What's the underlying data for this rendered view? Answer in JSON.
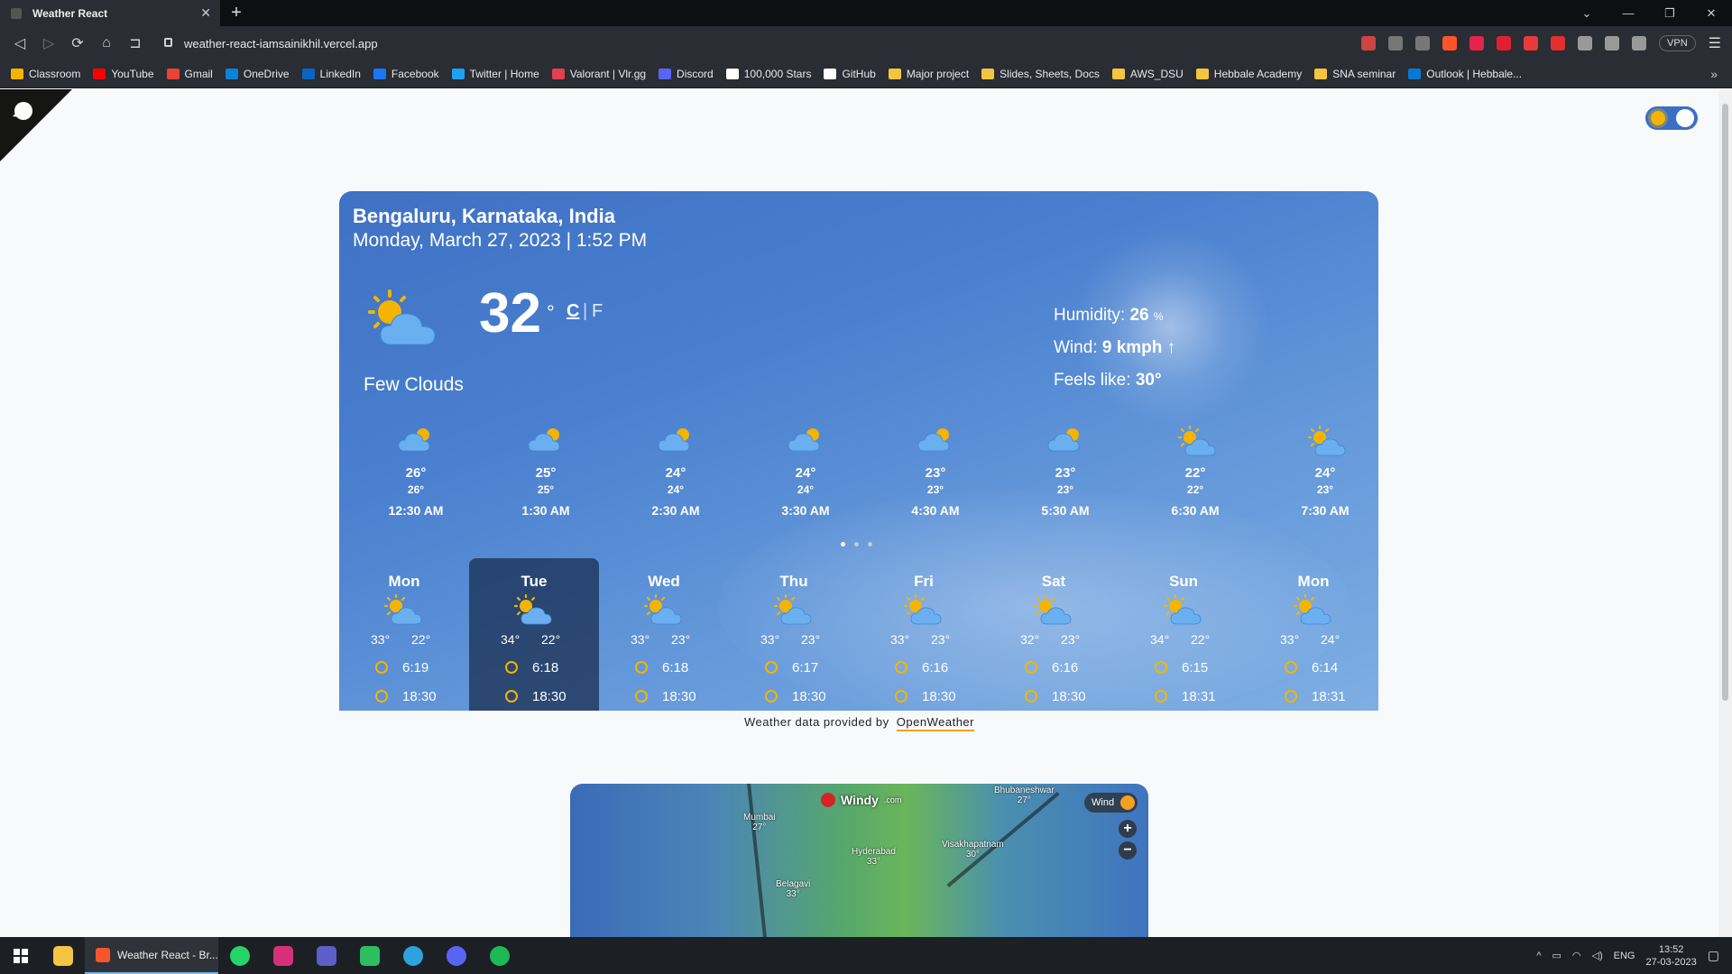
{
  "browser": {
    "tab_title": "Weather React",
    "url": "weather-react-iamsainikhil.vercel.app",
    "vpn_label": "VPN",
    "bookmarks": [
      {
        "label": "Classroom",
        "color": "#f4b400"
      },
      {
        "label": "YouTube",
        "color": "#ff0000"
      },
      {
        "label": "Gmail",
        "color": "#ea4335"
      },
      {
        "label": "OneDrive",
        "color": "#0a84d8"
      },
      {
        "label": "LinkedIn",
        "color": "#0a66c2"
      },
      {
        "label": "Facebook",
        "color": "#1877f2"
      },
      {
        "label": "Twitter | Home",
        "color": "#1da1f2"
      },
      {
        "label": "Valorant | Vlr.gg",
        "color": "#e04050"
      },
      {
        "label": "Discord",
        "color": "#5865f2"
      },
      {
        "label": "100,000 Stars",
        "color": "#ffffff"
      },
      {
        "label": "GitHub",
        "color": "#ffffff"
      },
      {
        "label": "Major project",
        "color": "#f5c542"
      },
      {
        "label": "Slides, Sheets, Docs",
        "color": "#f5c542"
      },
      {
        "label": "AWS_DSU",
        "color": "#f5c542"
      },
      {
        "label": "Hebbale Academy",
        "color": "#f5c542"
      },
      {
        "label": "SNA seminar",
        "color": "#f5c542"
      },
      {
        "label": "Outlook | Hebbale...",
        "color": "#0a78d4"
      }
    ],
    "more_bookmarks": "»"
  },
  "weather": {
    "location": "Bengaluru, Karnataka, India",
    "datetime": "Monday, March 27, 2023 | 1:52 PM",
    "temperature": "32",
    "degree_symbol": "°",
    "unit_c": "C",
    "unit_sep": "|",
    "unit_f": "F",
    "condition": "Few Clouds",
    "humidity_label": "Humidity:",
    "humidity_value": "26",
    "humidity_unit": "%",
    "wind_label": "Wind:",
    "wind_value": "9 kmph",
    "wind_arrow": "↑",
    "feels_label": "Feels like:",
    "feels_value": "30°"
  },
  "hourly": [
    {
      "temp": "26°",
      "feels": "26°",
      "time": "12:30 AM",
      "icon": "moon-cloud-icon"
    },
    {
      "temp": "25°",
      "feels": "25°",
      "time": "1:30 AM",
      "icon": "moon-cloud-icon"
    },
    {
      "temp": "24°",
      "feels": "24°",
      "time": "2:30 AM",
      "icon": "moon-cloud-icon"
    },
    {
      "temp": "24°",
      "feels": "24°",
      "time": "3:30 AM",
      "icon": "moon-cloud-icon"
    },
    {
      "temp": "23°",
      "feels": "23°",
      "time": "4:30 AM",
      "icon": "moon-cloud-icon"
    },
    {
      "temp": "23°",
      "feels": "23°",
      "time": "5:30 AM",
      "icon": "moon-cloud-icon"
    },
    {
      "temp": "22°",
      "feels": "22°",
      "time": "6:30 AM",
      "icon": "sun-cloud-icon"
    },
    {
      "temp": "24°",
      "feels": "23°",
      "time": "7:30 AM",
      "icon": "sun-cloud-icon"
    }
  ],
  "daily": [
    {
      "day": "Mon",
      "high": "33°",
      "low": "22°",
      "sunrise": "6:19",
      "sunset": "18:30",
      "selected": false
    },
    {
      "day": "Tue",
      "high": "34°",
      "low": "22°",
      "sunrise": "6:18",
      "sunset": "18:30",
      "selected": true
    },
    {
      "day": "Wed",
      "high": "33°",
      "low": "23°",
      "sunrise": "6:18",
      "sunset": "18:30",
      "selected": false
    },
    {
      "day": "Thu",
      "high": "33°",
      "low": "23°",
      "sunrise": "6:17",
      "sunset": "18:30",
      "selected": false
    },
    {
      "day": "Fri",
      "high": "33°",
      "low": "23°",
      "sunrise": "6:16",
      "sunset": "18:30",
      "selected": false
    },
    {
      "day": "Sat",
      "high": "32°",
      "low": "23°",
      "sunrise": "6:16",
      "sunset": "18:30",
      "selected": false
    },
    {
      "day": "Sun",
      "high": "34°",
      "low": "22°",
      "sunrise": "6:15",
      "sunset": "18:31",
      "selected": false
    },
    {
      "day": "Mon",
      "high": "33°",
      "low": "24°",
      "sunrise": "6:14",
      "sunset": "18:31",
      "selected": false
    }
  ],
  "footer": {
    "credit_text": "Weather data provided by",
    "credit_link": "OpenWeather"
  },
  "map": {
    "brand": "Windy",
    "brand_suffix": ".com",
    "layer_label": "Wind",
    "zoom_in": "+",
    "zoom_out": "−",
    "cities": [
      {
        "name": "Mumbai",
        "temp": "27°"
      },
      {
        "name": "Hyderabad",
        "temp": "33°"
      },
      {
        "name": "Visakhapatnam",
        "temp": "30°"
      },
      {
        "name": "Belagavi",
        "temp": "33°"
      },
      {
        "name": "Bhubaneshwar",
        "temp": "27°"
      }
    ]
  },
  "taskbar": {
    "active_app": "Weather React - Br...",
    "language": "ENG",
    "time": "13:52",
    "date": "27-03-2023"
  },
  "colors": {
    "card_gradient_start": "#3f71c4",
    "selected_day_bg": "#1c2e4f",
    "sun": "#f4b400",
    "credit_underline": "#f4a020"
  }
}
